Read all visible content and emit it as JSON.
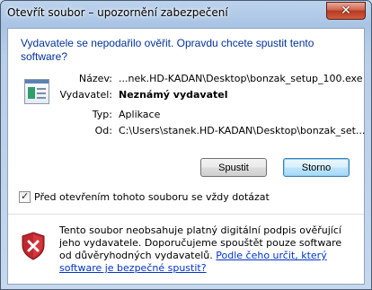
{
  "window": {
    "title": "Otevřít soubor – upozornění zabezpečení",
    "close_symbol": "✕"
  },
  "dialog": {
    "heading": "Vydavatele se nepodařilo ověřit. Opravdu chcete spustit tento software?",
    "file_icon": "application-icon",
    "fields": [
      {
        "label": "Název:",
        "value": "...nek.HD-KADAN\\Desktop\\bonzak_setup_100.exe",
        "bold": false
      },
      {
        "label": "Vydavatel:",
        "value": "Neznámý vydavatel",
        "bold": true
      },
      {
        "label": "Typ:",
        "value": "Aplikace",
        "bold": false
      },
      {
        "label": "Od:",
        "value": "C:\\Users\\stanek.HD-KADAN\\Desktop\\bonzak_set...",
        "bold": false
      }
    ],
    "buttons": {
      "run": "Spustit",
      "cancel": "Storno"
    },
    "checkbox": {
      "label": "Před otevřením tohoto souboru se vždy dotázat",
      "checked": true
    },
    "warning": {
      "icon": "shield-error-icon",
      "text": "Tento soubor neobsahuje platný digitální podpis ověřující jeho vydavatele. Doporučujeme spouštět pouze software od důvěryhodných vydavatelů.",
      "link": "Podle čeho určit, který software je bezpečné spustit?"
    }
  },
  "colors": {
    "heading": "#003399",
    "link": "#0033cc",
    "shield_red": "#c0272d"
  }
}
